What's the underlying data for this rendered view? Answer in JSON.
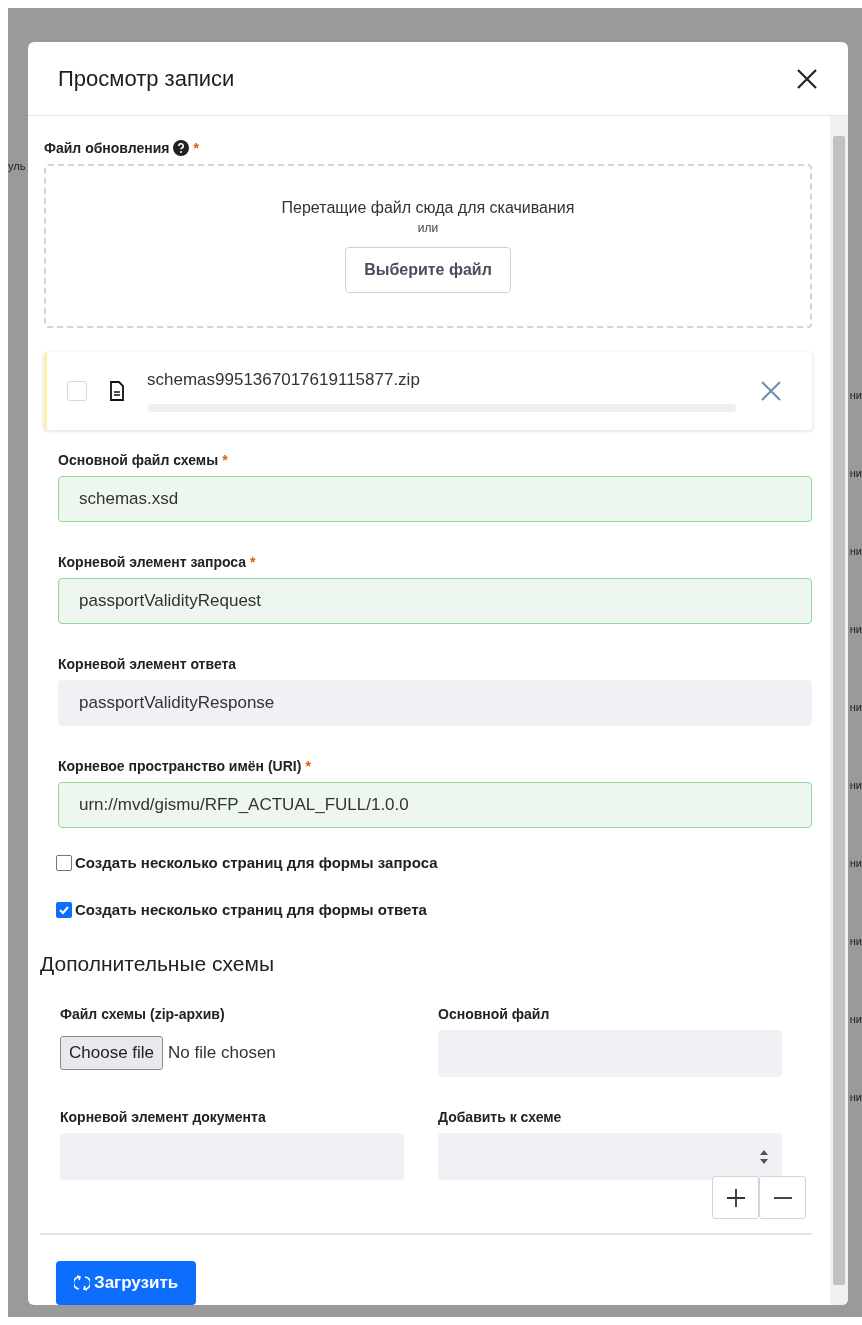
{
  "backdrop": {
    "left_fragment": "уль",
    "right_fragments": [
      "ни",
      "ни",
      "ни",
      "ни",
      "ни",
      "ни",
      "ни",
      "ни",
      "ни",
      "ни"
    ]
  },
  "modal": {
    "title": "Просмотр записи"
  },
  "upload": {
    "label": "Файл обновления",
    "required": "*",
    "drop_text": "Перетащие файл сюда для скачивания",
    "or_text": "или",
    "choose_button": "Выберите файл"
  },
  "file_item": {
    "name": "schemas9951367017619115877.zip",
    "checked": false
  },
  "fields": [
    {
      "label": "Основной файл схемы",
      "required": "*",
      "value": "schemas.xsd",
      "kind": "valid"
    },
    {
      "label": "Корневой элемент запроса",
      "required": "*",
      "value": "passportValidityRequest",
      "kind": "valid"
    },
    {
      "label": "Корневой элемент ответа",
      "value": "passportValidityResponse",
      "kind": "readonly"
    },
    {
      "label": "Корневое пространство имён (URI)",
      "required": "*",
      "value": "urn://mvd/gismu/RFP_ACTUAL_FULL/1.0.0",
      "kind": "valid"
    }
  ],
  "checkboxes": [
    {
      "label": "Создать несколько страниц для формы запроса",
      "checked": false
    },
    {
      "label": "Создать несколько страниц для формы ответа",
      "checked": true
    }
  ],
  "extra": {
    "heading": "Дополнительные схемы",
    "fields": [
      {
        "label": "Файл схемы (zip-архив)",
        "kind": "file",
        "button": "Choose file",
        "status": "No file chosen"
      },
      {
        "label": "Основной файл",
        "kind": "text"
      },
      {
        "label": "Корневой элемент документа",
        "kind": "text"
      },
      {
        "label": "Добавить к схеме",
        "kind": "select"
      }
    ]
  },
  "submit_button": "Загрузить"
}
